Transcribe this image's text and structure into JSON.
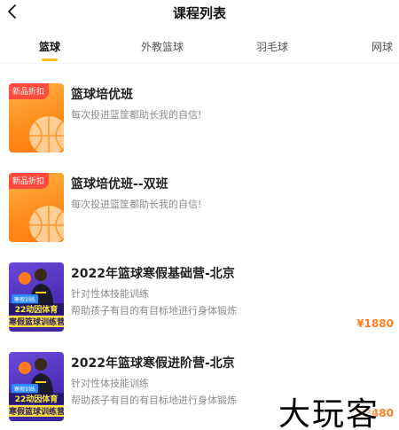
{
  "header": {
    "title": "课程列表",
    "back_icon": "chevron-left-icon"
  },
  "tabs": [
    {
      "label": "篮球",
      "active": true
    },
    {
      "label": "外教篮球",
      "active": false
    },
    {
      "label": "羽毛球",
      "active": false
    },
    {
      "label": "网球",
      "active": false
    }
  ],
  "accent_color": "#ffc21a",
  "price_color": "#ff7e1f",
  "courses": [
    {
      "tag": "新品折扣",
      "title": "篮球培优班",
      "lines": [
        "每次投进篮筐都助长我的自信!"
      ],
      "price": ""
    },
    {
      "tag": "新品折扣",
      "title": "篮球培优班--双班",
      "lines": [
        "每次投进篮筐都助长我的自信!"
      ],
      "price": ""
    },
    {
      "badge": "寒假训练",
      "banner_line1": "22动因体育",
      "banner_line2": "寒假篮球训练营",
      "title": "2022年篮球寒假基础营-北京",
      "lines": [
        "针对性体技能训练",
        "帮助孩子有目的有目标地进行身体锻炼"
      ],
      "price": "¥1880"
    },
    {
      "badge": "寒假训练",
      "banner_line1": "22动因体育",
      "banner_line2": "寒假篮球训练营",
      "title": "2022年篮球寒假进阶营-北京",
      "lines": [
        "针对性体技能训练",
        "帮助孩子有目的有目标地进行身体锻炼"
      ],
      "price": "¥2480"
    }
  ],
  "watermark": "大玩客"
}
